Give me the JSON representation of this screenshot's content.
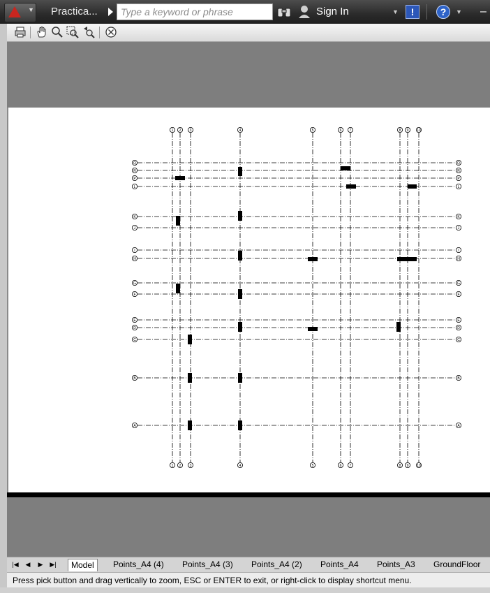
{
  "title_bar": {
    "app_menu_icon": "autocad-logo-icon",
    "document_title": "Practica...",
    "search_placeholder": "Type a keyword or phrase",
    "sign_in_label": "Sign In",
    "alert_label": "!",
    "help_label": "?",
    "minimize_label": "–"
  },
  "toolbar": {
    "icons": [
      "print-icon",
      "pan-hand-icon",
      "zoom-realtime-icon",
      "zoom-window-icon",
      "zoom-previous-icon",
      "close-preview-icon"
    ]
  },
  "drawing": {
    "vertical_grid_top": [
      "1",
      "2",
      "3",
      "4",
      "5",
      "6",
      "7",
      "8",
      "9",
      "10"
    ],
    "vertical_grid_bottom": [
      "1",
      "2",
      "3",
      "4",
      "5",
      "6",
      "7",
      "8",
      "9",
      "10"
    ],
    "horizontal_grid_left": [
      "Q",
      "R",
      "P",
      "L",
      "K",
      "J",
      "I",
      "H",
      "G",
      "F",
      "E",
      "D",
      "C",
      "B",
      "A"
    ],
    "horizontal_grid_right": [
      "Q",
      "R",
      "P",
      "L",
      "K",
      "J",
      "I",
      "H",
      "G",
      "F",
      "E",
      "D",
      "C",
      "B",
      "A"
    ]
  },
  "layout_tabs": {
    "nav_icons": [
      "first-tab-icon",
      "prev-tab-icon",
      "next-tab-icon",
      "last-tab-icon"
    ],
    "tabs": [
      "Model",
      "Points_A4 (4)",
      "Points_A4 (3)",
      "Points_A4 (2)",
      "Points_A4",
      "Points_A3",
      "GroundFloor"
    ],
    "active": "Model"
  },
  "status": {
    "message": "Press pick button and drag vertically to zoom, ESC or ENTER to exit, or right-click to display shortcut menu."
  },
  "colors": {
    "titlebar": "#2b2b2b",
    "alert": "#2c57b8",
    "help": "#2e63c8",
    "logo": "#c8261f"
  }
}
